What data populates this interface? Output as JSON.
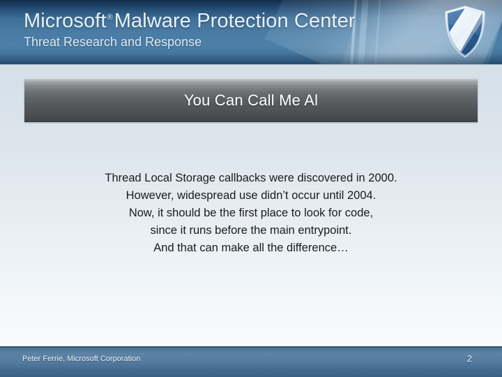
{
  "header": {
    "brand_title": "Microsoft",
    "registered_mark": "®",
    "brand_title_rest": "Malware Protection Center",
    "subtitle": "Threat Research and Response",
    "logo_icon": "shield-icon",
    "background_color": "#4a7ca5",
    "text_color": "#e9f2f8"
  },
  "slide": {
    "title": "You Can Call Me Al",
    "title_bar_color": "#55595c",
    "background_color": "#dde5ec",
    "body_lines": [
      "Thread Local Storage callbacks were discovered in 2000.",
      "However, widespread use didn’t occur until 2004.",
      "Now, it should be the first place to look for code,",
      "since it runs before the main entrypoint.",
      "And that can make all the difference…"
    ]
  },
  "footer": {
    "attribution": "Peter Ferrie, Microsoft Corporation",
    "page_number": "2",
    "background_color": "#55809f",
    "text_color": "#eef4f9"
  }
}
